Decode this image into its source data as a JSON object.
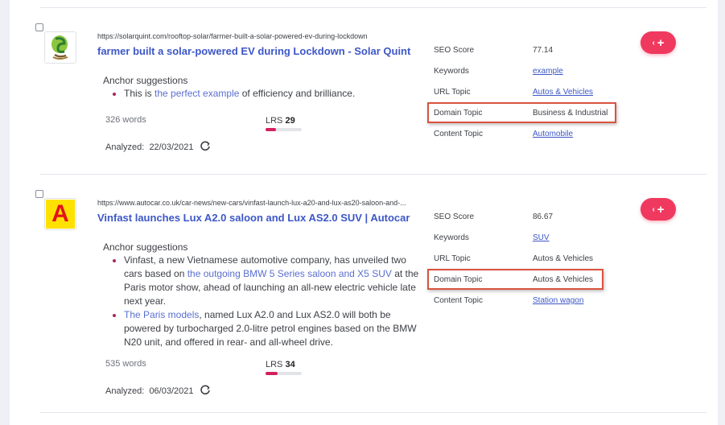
{
  "results": [
    {
      "url": "https://solarquint.com/rooftop-solar/farmer-built-a-solar-powered-ev-during-lockdown",
      "title": "farmer built a solar-powered EV during Lockdown - Solar Quint",
      "anchor_heading": "Anchor suggestions",
      "suggestions": [
        {
          "before": "This is ",
          "link": "the perfect example",
          "after": " of efficiency and brilliance."
        }
      ],
      "words": "326 words",
      "lrs_label": "LRS",
      "lrs_value": "29",
      "lrs_fraction": 0.29,
      "analyzed_label": "Analyzed:",
      "analyzed_date": "22/03/2021",
      "metrics": {
        "seo_label": "SEO Score",
        "seo_value": "77.14",
        "keywords_label": "Keywords",
        "keywords_value": "example",
        "url_topic_label": "URL Topic",
        "url_topic_value": "Autos & Vehicles",
        "domain_topic_label": "Domain Topic",
        "domain_topic_value": "Business & Industrial",
        "content_topic_label": "Content Topic",
        "content_topic_value": "Automobile"
      },
      "logo_icon": "solar-leaf-logo"
    },
    {
      "url": "https://www.autocar.co.uk/car-news/new-cars/vinfast-launch-lux-a20-and-lux-as20-saloon-and-...",
      "title": "Vinfast launches Lux A2.0 saloon and Lux AS2.0 SUV | Autocar",
      "anchor_heading": "Anchor suggestions",
      "suggestions": [
        {
          "before": "Vinfast, a new Vietnamese automotive company, has unveiled two cars based on ",
          "link": "the outgoing BMW 5 Series saloon and X5 SUV",
          "after": " at the Paris motor show, ahead of launching an all-new electric vehicle late next year."
        },
        {
          "before": "",
          "link": "The Paris models",
          "after": ", named Lux A2.0 and Lux AS2.0 will both be powered by turbocharged 2.0-litre petrol engines based on the BMW N20 unit, and offered in rear- and all-wheel drive."
        }
      ],
      "words": "535 words",
      "lrs_label": "LRS",
      "lrs_value": "34",
      "lrs_fraction": 0.34,
      "analyzed_label": "Analyzed:",
      "analyzed_date": "06/03/2021",
      "metrics": {
        "seo_label": "SEO Score",
        "seo_value": "86.67",
        "keywords_label": "Keywords",
        "keywords_value": "SUV",
        "url_topic_label": "URL Topic",
        "url_topic_value": "Autos & Vehicles",
        "domain_topic_label": "Domain Topic",
        "domain_topic_value": "Autos & Vehicles",
        "content_topic_label": "Content Topic",
        "content_topic_value": "Station wagon"
      },
      "logo_icon": "autocar-a-logo",
      "logo_letter": "A"
    }
  ],
  "add_button_label": "+",
  "colors": {
    "accent": "#f0395e",
    "link": "#3d57c7",
    "highlight": "#d9533f",
    "lrs_bar": "#d3205d"
  }
}
